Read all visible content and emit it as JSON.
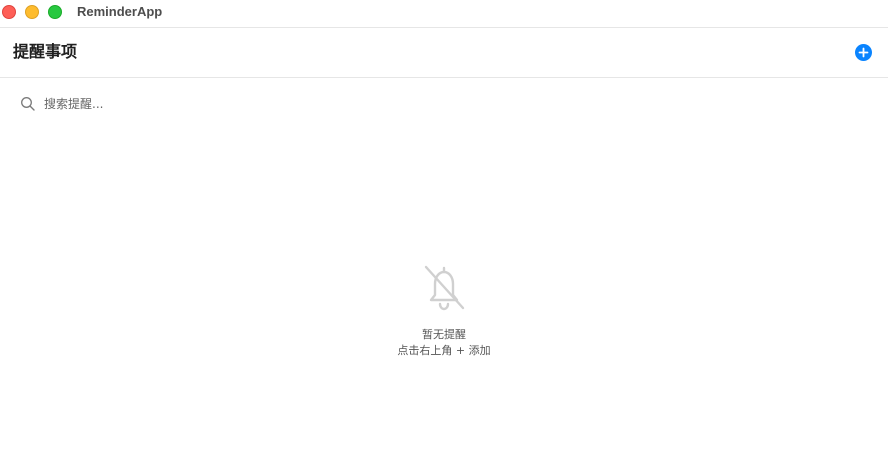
{
  "window": {
    "app_title": "ReminderApp"
  },
  "header": {
    "title": "提醒事项",
    "add_icon": "plus-circle-icon",
    "accent_color": "#0a84ff"
  },
  "search": {
    "placeholder": "搜索提醒...",
    "value": "",
    "icon": "search-icon"
  },
  "empty_state": {
    "icon": "bell-slash-icon",
    "title": "暂无提醒",
    "hint": "点击右上角 + 添加"
  }
}
